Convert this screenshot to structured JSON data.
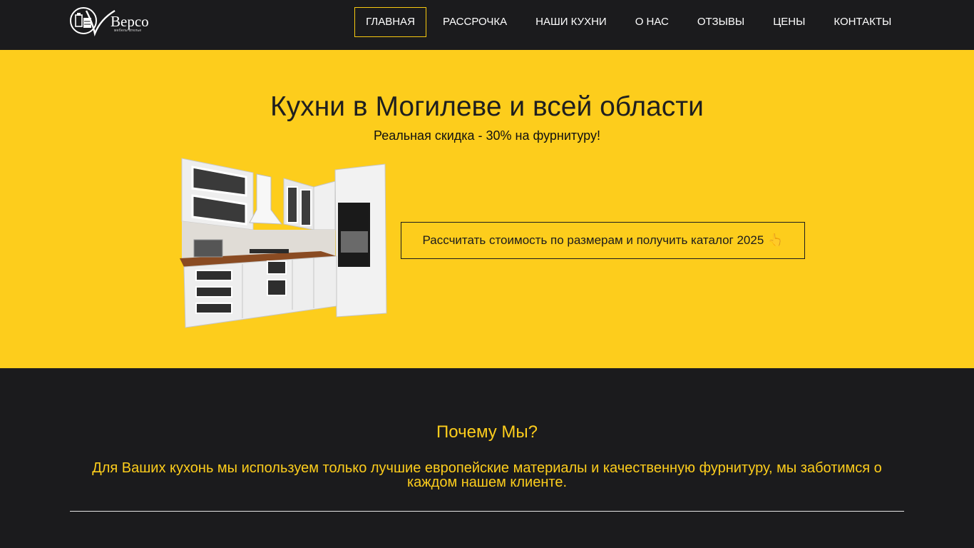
{
  "header": {
    "logo": {
      "text": "Версо",
      "subtext": "мебель-ателье",
      "icon": "logo-emblem-icon"
    },
    "nav": [
      {
        "label": "ГЛАВНАЯ",
        "active": true
      },
      {
        "label": "РАССРОЧКА",
        "active": false
      },
      {
        "label": "НАШИ КУХНИ",
        "active": false
      },
      {
        "label": "О НАС",
        "active": false
      },
      {
        "label": "ОТЗЫВЫ",
        "active": false
      },
      {
        "label": "ЦЕНЫ",
        "active": false
      },
      {
        "label": "КОНТАКТЫ",
        "active": false
      }
    ]
  },
  "hero": {
    "title": "Кухни в Могилеве и всей области",
    "subtitle": "Реальная скидка - 30% на фурнитуру!",
    "cta_label": "Рассчитать стоимость по размерам и получить каталог 2025",
    "cta_icon": "pointing-hand-icon",
    "image": "kitchen-image"
  },
  "why": {
    "title": "Почему Мы?",
    "text": "Для Ваших кухонь мы используем только лучшие европейские материалы и качественную фурнитуру, мы заботимся о каждом нашем клиенте."
  },
  "colors": {
    "accent": "#fdcd1c",
    "dark": "#1b1b1d",
    "text_light": "#ffffff"
  }
}
